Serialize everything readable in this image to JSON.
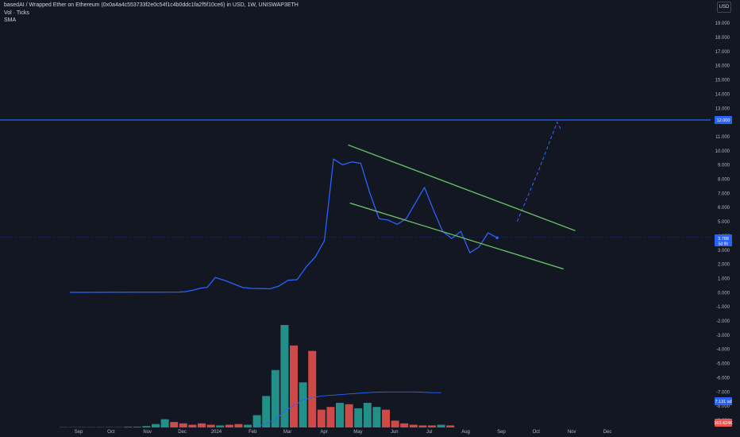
{
  "legend": {
    "symbol": "basedAI / Wrapped Ether on Ethereum (0x0a4a4c553733f2e0c54f1c4b0ddc1fa2f5f10ce6) in USD, 1W, UNISWAP3ETH",
    "indicator1": "Vol · Ticks",
    "indicator2": "SMA"
  },
  "currency_button": "USD",
  "colors": {
    "background": "#131722",
    "price_line": "#2962ff",
    "channel": "#66bb6a",
    "horizontal": "#2962ff",
    "vol_up": "#26a69a",
    "vol_down": "#ef5350",
    "sma": "#2962ff",
    "axis_text": "#b2b5be"
  },
  "chart_data": {
    "type": "line",
    "price_scale_ticks": [
      "19.000",
      "18.000",
      "17.000",
      "16.000",
      "15.000",
      "14.000",
      "13.000",
      "12.000",
      "11.000",
      "10.000",
      "9.000",
      "8.000",
      "7.000",
      "6.000",
      "5.000",
      "4.000",
      "3.000",
      "2.000",
      "1.000",
      "0.000",
      "-1.000",
      "-2.000",
      "-3.000",
      "-4.000",
      "-5.000",
      "-6.000",
      "-7.000",
      "-8.000",
      "-9.000"
    ],
    "ylim": [
      -9.5,
      20
    ],
    "time_ticks": [
      {
        "label": "Sep",
        "x": -4
      },
      {
        "label": "Oct",
        "x": 0
      },
      {
        "label": "Nov",
        "x": 4.5
      },
      {
        "label": "Dec",
        "x": 8.8
      },
      {
        "label": "2024",
        "x": 13
      },
      {
        "label": "Feb",
        "x": 17.5
      },
      {
        "label": "Mar",
        "x": 21.8
      },
      {
        "label": "Apr",
        "x": 26.3
      },
      {
        "label": "May",
        "x": 30.5
      },
      {
        "label": "Jun",
        "x": 35
      },
      {
        "label": "Jul",
        "x": 39.3
      },
      {
        "label": "Aug",
        "x": 43.8
      },
      {
        "label": "Sep",
        "x": 48.2
      },
      {
        "label": "Oct",
        "x": 52.5
      },
      {
        "label": "Nov",
        "x": 56.9
      },
      {
        "label": "Dec",
        "x": 61.3
      }
    ],
    "xlim": [
      -5,
      62.5
    ],
    "price_series": {
      "x": [
        -5,
        1,
        5,
        7,
        10,
        11,
        12,
        13,
        14,
        16,
        17,
        18,
        20,
        21,
        22,
        23,
        24,
        25,
        26,
        27,
        28,
        29,
        30,
        31,
        32,
        33,
        34,
        35,
        36,
        37,
        38,
        39,
        40,
        41,
        42,
        43,
        44
      ],
      "values": [
        0,
        0,
        0,
        0,
        0,
        0,
        0,
        0,
        0,
        0,
        0,
        0,
        0,
        0,
        0,
        0,
        0,
        0,
        0,
        0,
        0,
        0,
        0,
        0,
        0,
        0,
        0,
        0,
        0,
        0,
        0,
        0,
        0,
        0,
        0,
        0,
        0
      ]
    },
    "price_points": [
      [
        -6,
        0.0
      ],
      [
        6,
        0.02
      ],
      [
        6.7,
        0.05
      ],
      [
        7.5,
        0.15
      ],
      [
        8.4,
        0.3
      ],
      [
        9.1,
        0.35
      ],
      [
        10,
        1.05
      ],
      [
        11,
        0.85
      ],
      [
        12,
        0.6
      ],
      [
        13,
        0.35
      ],
      [
        14,
        0.28
      ],
      [
        15,
        0.27
      ],
      [
        16,
        0.25
      ],
      [
        17,
        0.45
      ],
      [
        18,
        0.85
      ],
      [
        19,
        0.9
      ],
      [
        20,
        1.8
      ],
      [
        21,
        2.5
      ],
      [
        22,
        3.65
      ],
      [
        23,
        9.4
      ],
      [
        24,
        9.0
      ],
      [
        25,
        9.2
      ],
      [
        26,
        9.1
      ],
      [
        27,
        7.0
      ],
      [
        28,
        5.2
      ],
      [
        29,
        5.1
      ],
      [
        30,
        4.8
      ],
      [
        31,
        5.2
      ],
      [
        32,
        6.3
      ],
      [
        33,
        7.4
      ],
      [
        34,
        5.8
      ],
      [
        35,
        4.3
      ],
      [
        36,
        3.8
      ],
      [
        37,
        4.3
      ],
      [
        38,
        2.8
      ],
      [
        39,
        3.2
      ],
      [
        40,
        4.2
      ],
      [
        41,
        3.85
      ]
    ],
    "projection_points": [
      [
        43.2,
        5.0
      ],
      [
        45.5,
        8.5
      ],
      [
        47.6,
        12.0
      ],
      [
        48,
        11.5
      ]
    ],
    "last_price": "3.788",
    "last_price_sub": "5d 9h",
    "horizontal_level": {
      "value": 12.0,
      "label": "12.000"
    },
    "channel_upper": [
      [
        24.6,
        10.4
      ],
      [
        49.6,
        4.35
      ]
    ],
    "channel_lower": [
      [
        24.8,
        6.3
      ],
      [
        48.3,
        1.65
      ]
    ],
    "volume": {
      "x": [
        -1,
        0,
        1,
        2,
        3,
        4,
        5,
        6,
        7,
        8,
        9,
        10,
        11,
        12,
        13,
        14,
        15,
        16,
        17,
        18,
        19,
        20,
        21,
        22,
        23,
        24,
        25,
        26,
        27,
        28,
        29,
        30,
        31,
        32,
        33,
        34,
        35,
        36,
        37,
        38,
        39,
        40,
        41
      ],
      "values": [
        0.02,
        0.02,
        0.02,
        0.02,
        0.02,
        0.02,
        0.02,
        0.05,
        0.05,
        0.1,
        0.25,
        0.6,
        0.4,
        0.3,
        0.2,
        0.3,
        0.2,
        0.15,
        0.2,
        0.25,
        0.2,
        0.9,
        2.3,
        4.2,
        7.5,
        6.0,
        3.3,
        5.6,
        1.3,
        1.5,
        1.8,
        1.7,
        1.4,
        1.8,
        1.5,
        1.3,
        0.5,
        0.3,
        0.2,
        0.15,
        0.15,
        0.2,
        0.15
      ],
      "up": [
        true,
        true,
        true,
        true,
        true,
        true,
        true,
        true,
        false,
        true,
        true,
        true,
        false,
        false,
        false,
        false,
        false,
        true,
        false,
        false,
        true,
        true,
        true,
        true,
        true,
        false,
        true,
        false,
        false,
        false,
        true,
        false,
        true,
        true,
        true,
        false,
        false,
        false,
        false,
        false,
        false,
        true,
        false
      ],
      "last_label": "7.131",
      "last_label_suffix": "sd"
    },
    "sma": [
      [
        20,
        0.05
      ],
      [
        21,
        0.3
      ],
      [
        22,
        0.55
      ],
      [
        23,
        1.2
      ],
      [
        24,
        1.6
      ],
      [
        25,
        2.0
      ],
      [
        26,
        2.2
      ],
      [
        27,
        2.3
      ],
      [
        28,
        2.35
      ],
      [
        29,
        2.4
      ],
      [
        30,
        2.45
      ],
      [
        31,
        2.5
      ],
      [
        32,
        2.55
      ],
      [
        33,
        2.58
      ],
      [
        34,
        2.6
      ],
      [
        35,
        2.6
      ],
      [
        36,
        2.6
      ],
      [
        37,
        2.6
      ],
      [
        38,
        2.58
      ],
      [
        39,
        2.55
      ],
      [
        40,
        2.55
      ]
    ],
    "bottom_label": "163.424K"
  }
}
